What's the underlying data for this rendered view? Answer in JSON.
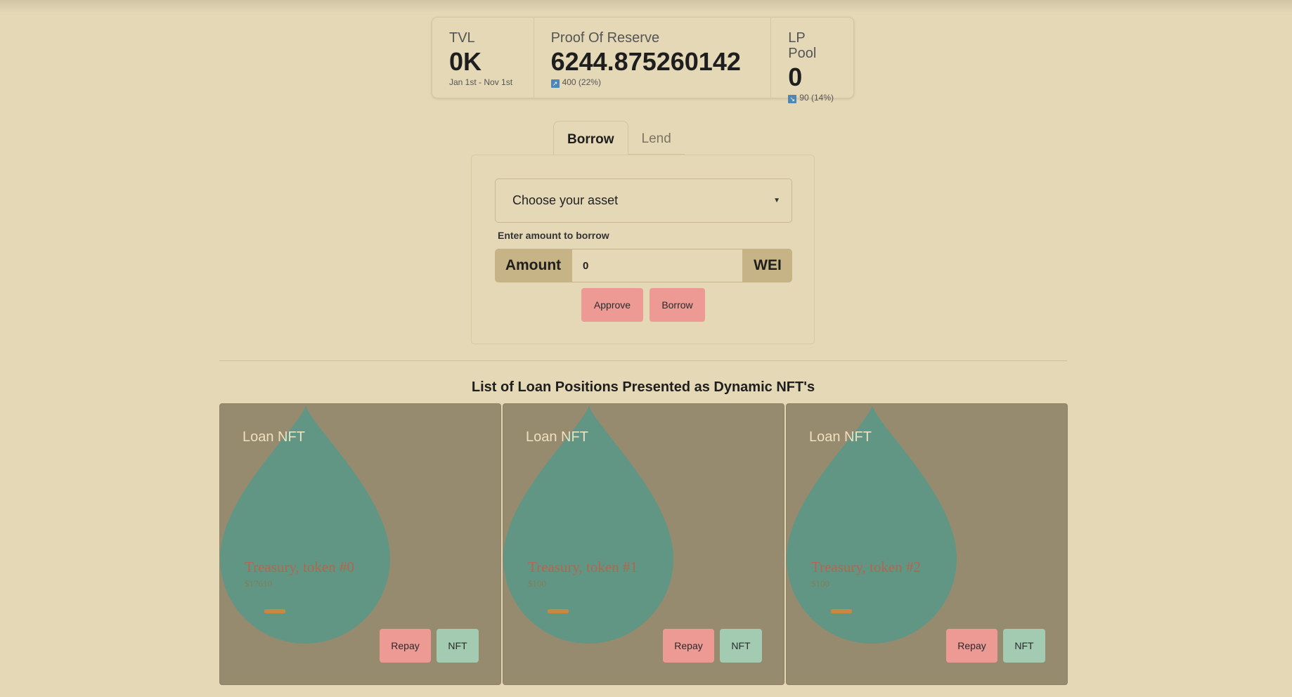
{
  "stats": [
    {
      "title": "TVL",
      "value": "0K",
      "desc": "Jan 1st - Nov 1st"
    },
    {
      "title": "Proof Of Reserve",
      "value": "6244.875260142",
      "desc": "400 (22%)",
      "trend": "up"
    },
    {
      "title": "LP Pool",
      "value": "0",
      "desc": "90 (14%)",
      "trend": "down"
    }
  ],
  "tabs": {
    "borrow": "Borrow",
    "lend": "Lend"
  },
  "form": {
    "asset_select": "Choose your asset",
    "amount_label": "Enter amount to borrow",
    "amount_prefix": "Amount",
    "amount_value": "0",
    "amount_suffix": "WEI",
    "approve_label": "Approve",
    "borrow_label": "Borrow"
  },
  "section_title": "List of Loan Positions Presented as Dynamic NFT's",
  "cards": [
    {
      "title": "Loan NFT",
      "token": "Treasury, token #0",
      "price": "$17610",
      "repay": "Repay",
      "nft": "NFT"
    },
    {
      "title": "Loan NFT",
      "token": "Treasury, token #1",
      "price": "$100",
      "repay": "Repay",
      "nft": "NFT"
    },
    {
      "title": "Loan NFT",
      "token": "Treasury, token #2",
      "price": "$100",
      "repay": "Repay",
      "nft": "NFT"
    }
  ],
  "colors": {
    "background": "#e4d8b6",
    "card": "#978b6f",
    "drop": "#619684",
    "pink_button": "#ed9a95",
    "green_button": "#a2cbb1",
    "addon": "#c7b486"
  }
}
